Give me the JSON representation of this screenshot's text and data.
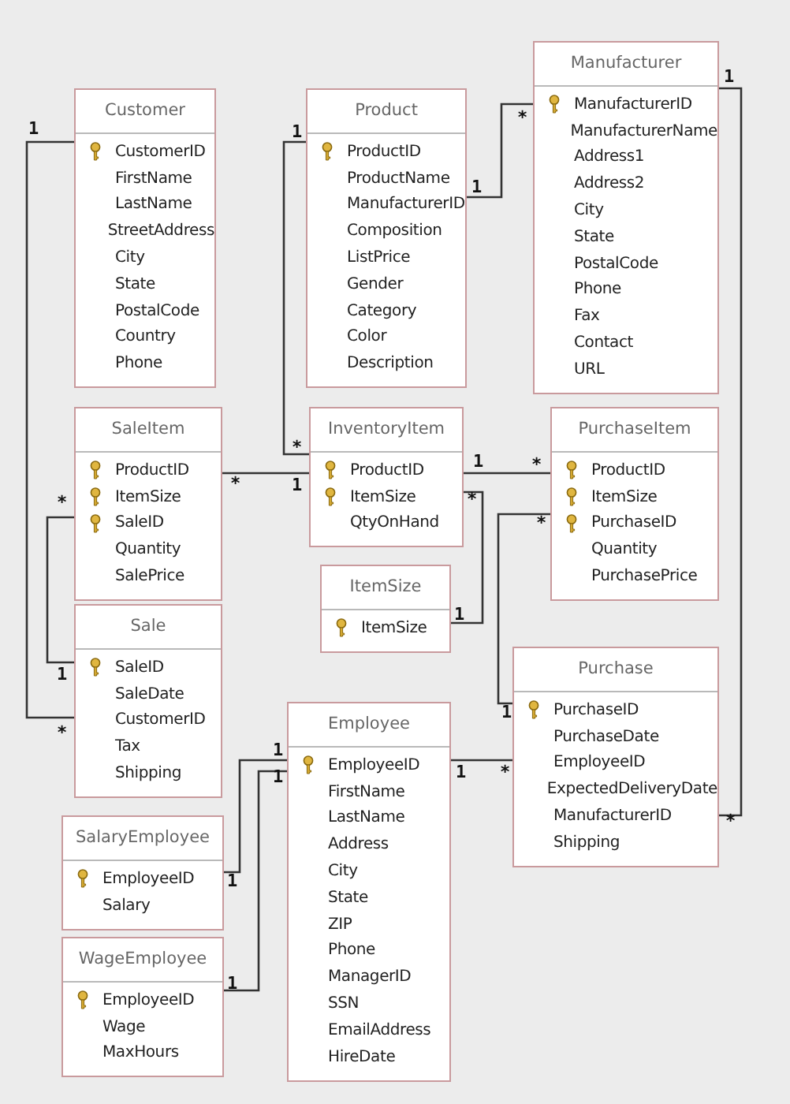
{
  "tables": [
    {
      "title": "Customer",
      "fields": [
        {
          "name": "CustomerID",
          "primary_key": true
        },
        {
          "name": "FirstName",
          "primary_key": false
        },
        {
          "name": "LastName",
          "primary_key": false
        },
        {
          "name": "StreetAddress",
          "primary_key": false
        },
        {
          "name": "City",
          "primary_key": false
        },
        {
          "name": "State",
          "primary_key": false
        },
        {
          "name": "PostalCode",
          "primary_key": false
        },
        {
          "name": "Country",
          "primary_key": false
        },
        {
          "name": "Phone",
          "primary_key": false
        }
      ]
    },
    {
      "title": "Product",
      "fields": [
        {
          "name": "ProductID",
          "primary_key": true
        },
        {
          "name": "ProductName",
          "primary_key": false
        },
        {
          "name": "ManufacturerID",
          "primary_key": false
        },
        {
          "name": "Composition",
          "primary_key": false
        },
        {
          "name": "ListPrice",
          "primary_key": false
        },
        {
          "name": "Gender",
          "primary_key": false
        },
        {
          "name": "Category",
          "primary_key": false
        },
        {
          "name": "Color",
          "primary_key": false
        },
        {
          "name": "Description",
          "primary_key": false
        }
      ]
    },
    {
      "title": "Manufacturer",
      "fields": [
        {
          "name": "ManufacturerID",
          "primary_key": true
        },
        {
          "name": "ManufacturerName",
          "primary_key": false
        },
        {
          "name": "Address1",
          "primary_key": false
        },
        {
          "name": "Address2",
          "primary_key": false
        },
        {
          "name": "City",
          "primary_key": false
        },
        {
          "name": "State",
          "primary_key": false
        },
        {
          "name": "PostalCode",
          "primary_key": false
        },
        {
          "name": "Phone",
          "primary_key": false
        },
        {
          "name": "Fax",
          "primary_key": false
        },
        {
          "name": "Contact",
          "primary_key": false
        },
        {
          "name": "URL",
          "primary_key": false
        }
      ]
    },
    {
      "title": "SaleItem",
      "fields": [
        {
          "name": "ProductID",
          "primary_key": true
        },
        {
          "name": "ItemSize",
          "primary_key": true
        },
        {
          "name": "SaleID",
          "primary_key": true
        },
        {
          "name": "Quantity",
          "primary_key": false
        },
        {
          "name": "SalePrice",
          "primary_key": false
        }
      ]
    },
    {
      "title": "InventoryItem",
      "fields": [
        {
          "name": "ProductID",
          "primary_key": true
        },
        {
          "name": "ItemSize",
          "primary_key": true
        },
        {
          "name": "QtyOnHand",
          "primary_key": false
        }
      ]
    },
    {
      "title": "PurchaseItem",
      "fields": [
        {
          "name": "ProductID",
          "primary_key": true
        },
        {
          "name": "ItemSize",
          "primary_key": true
        },
        {
          "name": "PurchaseID",
          "primary_key": true
        },
        {
          "name": "Quantity",
          "primary_key": false
        },
        {
          "name": "PurchasePrice",
          "primary_key": false
        }
      ]
    },
    {
      "title": "ItemSize",
      "fields": [
        {
          "name": "ItemSize",
          "primary_key": true
        }
      ]
    },
    {
      "title": "Sale",
      "fields": [
        {
          "name": "SaleID",
          "primary_key": true
        },
        {
          "name": "SaleDate",
          "primary_key": false
        },
        {
          "name": "CustomerID",
          "primary_key": false
        },
        {
          "name": "Tax",
          "primary_key": false
        },
        {
          "name": "Shipping",
          "primary_key": false
        }
      ]
    },
    {
      "title": "Purchase",
      "fields": [
        {
          "name": "PurchaseID",
          "primary_key": true
        },
        {
          "name": "PurchaseDate",
          "primary_key": false
        },
        {
          "name": "EmployeeID",
          "primary_key": false
        },
        {
          "name": "ExpectedDeliveryDate",
          "primary_key": false
        },
        {
          "name": "ManufacturerID",
          "primary_key": false
        },
        {
          "name": "Shipping",
          "primary_key": false
        }
      ]
    },
    {
      "title": "Employee",
      "fields": [
        {
          "name": "EmployeeID",
          "primary_key": true
        },
        {
          "name": "FirstName",
          "primary_key": false
        },
        {
          "name": "LastName",
          "primary_key": false
        },
        {
          "name": "Address",
          "primary_key": false
        },
        {
          "name": "City",
          "primary_key": false
        },
        {
          "name": "State",
          "primary_key": false
        },
        {
          "name": "ZIP",
          "primary_key": false
        },
        {
          "name": "Phone",
          "primary_key": false
        },
        {
          "name": "ManagerID",
          "primary_key": false
        },
        {
          "name": "SSN",
          "primary_key": false
        },
        {
          "name": "EmailAddress",
          "primary_key": false
        },
        {
          "name": "HireDate",
          "primary_key": false
        }
      ]
    },
    {
      "title": "SalaryEmployee",
      "fields": [
        {
          "name": "EmployeeID",
          "primary_key": true
        },
        {
          "name": "Salary",
          "primary_key": false
        }
      ]
    },
    {
      "title": "WageEmployee",
      "fields": [
        {
          "name": "EmployeeID",
          "primary_key": true
        },
        {
          "name": "Wage",
          "primary_key": false
        },
        {
          "name": "MaxHours",
          "primary_key": false
        }
      ]
    }
  ],
  "relationships": [
    {
      "end_1": "1",
      "end_2": "*"
    },
    {
      "end_1": "1",
      "end_2": "*"
    },
    {
      "end_1": "1",
      "end_2": "*"
    },
    {
      "end_1": "1",
      "end_2": "*"
    },
    {
      "end_1": "*",
      "end_2": "1"
    },
    {
      "end_1": "*",
      "end_2": "1"
    },
    {
      "end_1": "1",
      "end_2": "*"
    },
    {
      "end_1": "*",
      "end_2": "1"
    },
    {
      "end_1": "*",
      "end_2": "1"
    },
    {
      "end_1": "1",
      "end_2": "*"
    },
    {
      "end_1": "1",
      "end_2": "1"
    },
    {
      "end_1": "1",
      "end_2": "1"
    }
  ]
}
